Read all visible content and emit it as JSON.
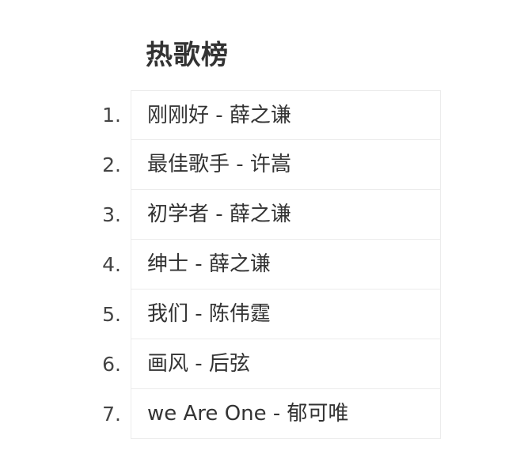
{
  "chart_title": "热歌榜",
  "songs": [
    {
      "rank": "1.",
      "text": "刚刚好 - 薛之谦"
    },
    {
      "rank": "2.",
      "text": "最佳歌手 - 许嵩"
    },
    {
      "rank": "3.",
      "text": "初学者 - 薛之谦"
    },
    {
      "rank": "4.",
      "text": "绅士 - 薛之谦"
    },
    {
      "rank": "5.",
      "text": "我们 - 陈伟霆"
    },
    {
      "rank": "6.",
      "text": "画风 - 后弦"
    },
    {
      "rank": "7.",
      "text": "we Are One - 郁可唯"
    }
  ]
}
